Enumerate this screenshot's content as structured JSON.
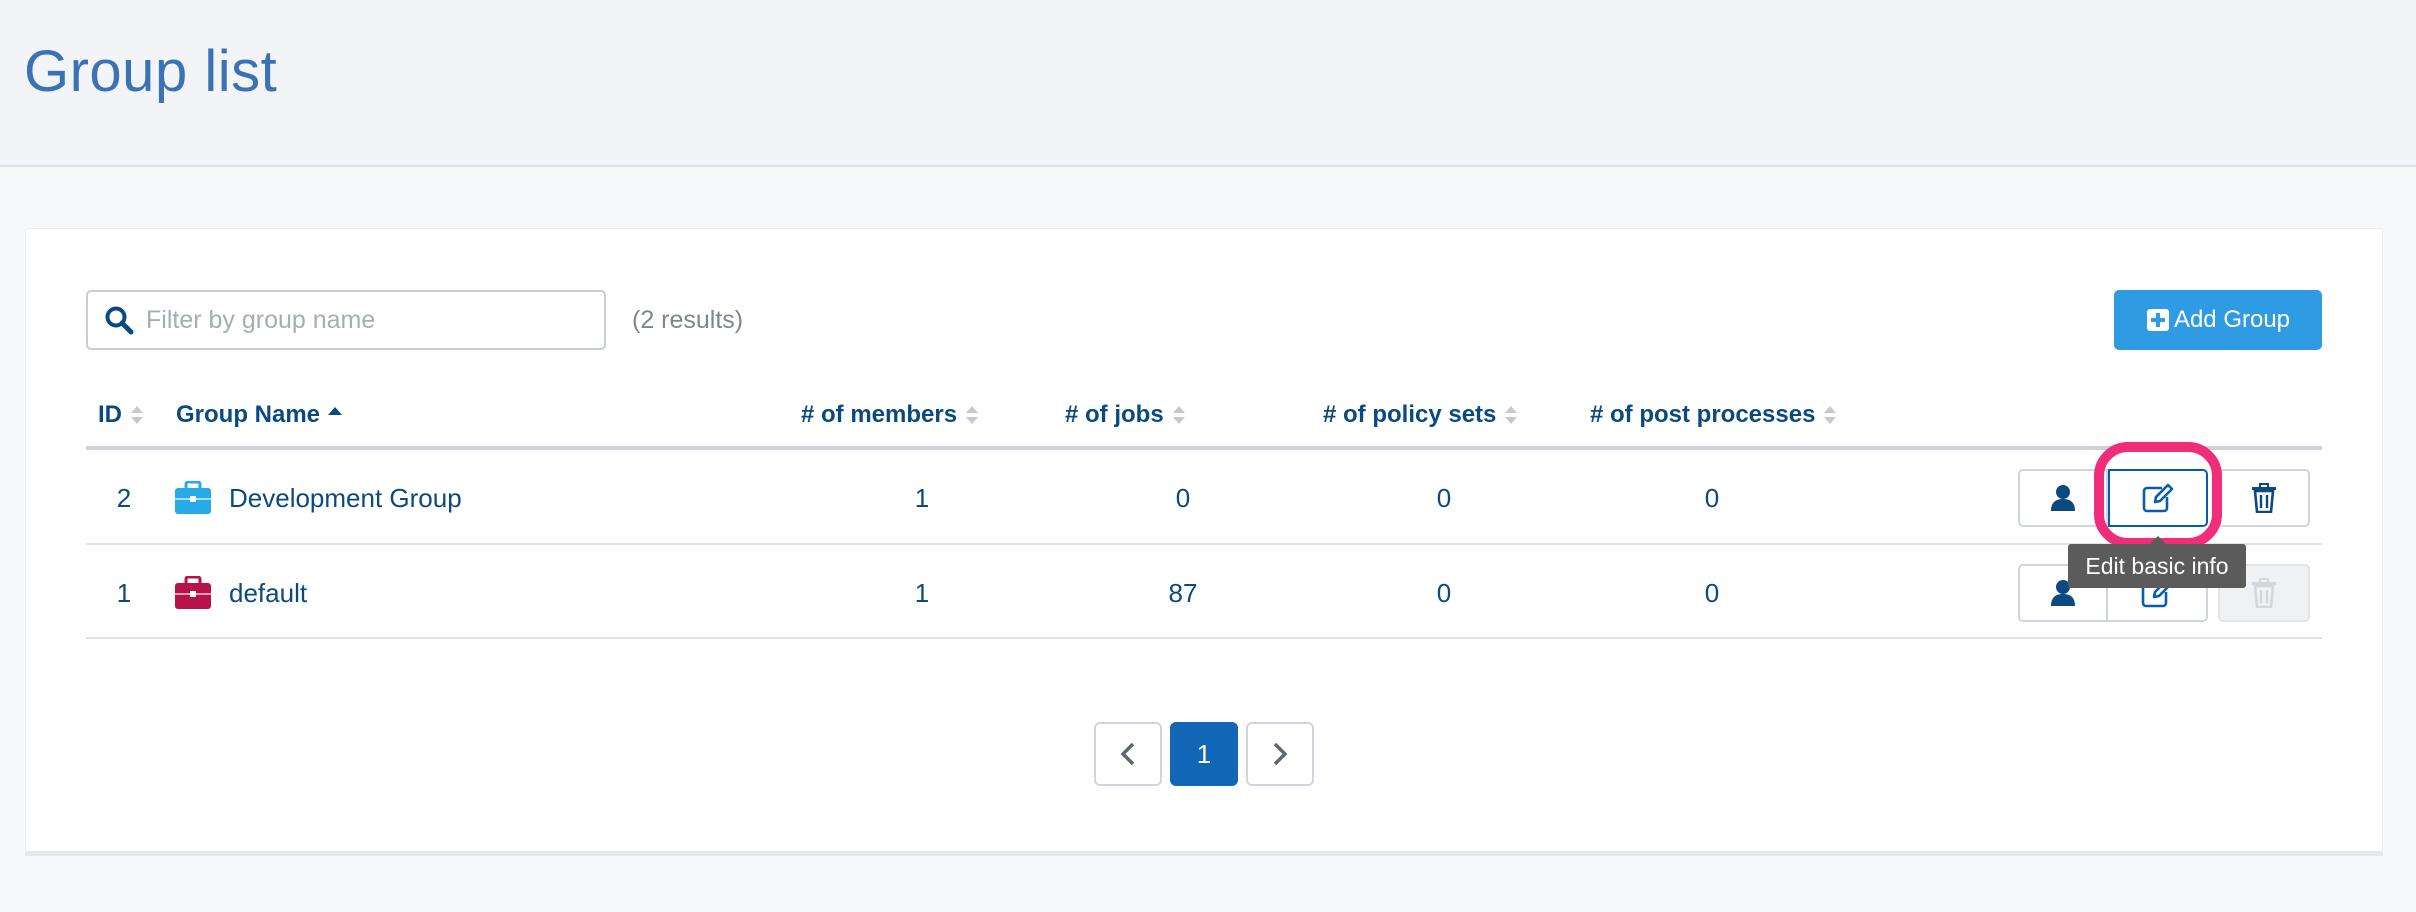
{
  "page": {
    "title": "Group list"
  },
  "filter": {
    "placeholder": "Filter by group name",
    "value": "",
    "results": "(2 results)"
  },
  "toolbar": {
    "add_label": "Add Group"
  },
  "table": {
    "columns": [
      "ID",
      "Group Name",
      "# of members",
      "# of jobs",
      "# of policy sets",
      "# of post processes"
    ],
    "sorted_column": "Group Name",
    "sort_direction": "ascending",
    "rows": [
      {
        "id": "2",
        "name": "Development Group",
        "icon_color": "#29aae8",
        "members": "1",
        "jobs": "0",
        "policy_sets": "0",
        "post_processes": "0",
        "delete_enabled": true
      },
      {
        "id": "1",
        "name": "default",
        "icon_color": "#b8124a",
        "members": "1",
        "jobs": "87",
        "policy_sets": "0",
        "post_processes": "0",
        "delete_enabled": false
      }
    ]
  },
  "tooltip": {
    "text": "Edit basic info"
  },
  "pagination": {
    "current": "1"
  },
  "icons": {
    "search": "search-icon",
    "add": "plus-square-icon",
    "group": "briefcase-icon",
    "members": "user-icon",
    "edit": "edit-icon",
    "delete": "trash-icon",
    "prev": "chevron-left-icon",
    "next": "chevron-right-icon"
  },
  "colors": {
    "accent": "#2e9be3",
    "highlight": "#ef2d7a",
    "primary_text": "#0b4a80"
  }
}
